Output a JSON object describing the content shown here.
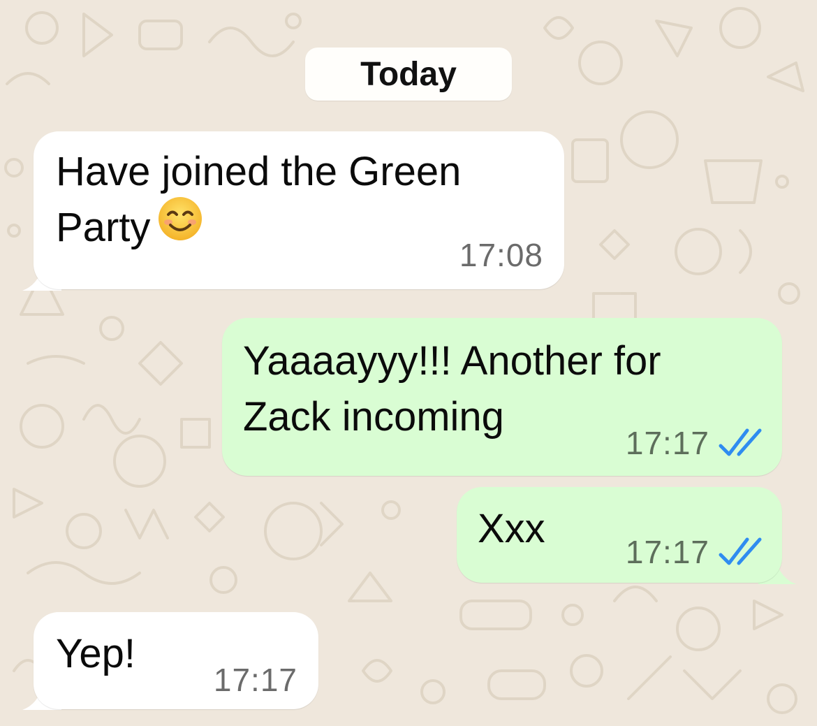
{
  "chat": {
    "date_divider": "Today",
    "messages": [
      {
        "direction": "incoming",
        "text": "Have joined the Green\nParty",
        "emoji": "smiling-face-with-smiling-eyes",
        "time": "17:08"
      },
      {
        "direction": "outgoing",
        "text": "Yaaaayyy!!! Another for\nZack incoming",
        "time": "17:17",
        "status": "read"
      },
      {
        "direction": "outgoing",
        "text": "Xxx",
        "time": "17:17",
        "status": "read"
      },
      {
        "direction": "incoming",
        "text": "Yep!",
        "time": "17:17"
      }
    ]
  },
  "colors": {
    "background": "#efe7dc",
    "incoming_bubble": "#ffffff",
    "outgoing_bubble": "#d9fdd3",
    "read_ticks": "#2f8cf0"
  }
}
